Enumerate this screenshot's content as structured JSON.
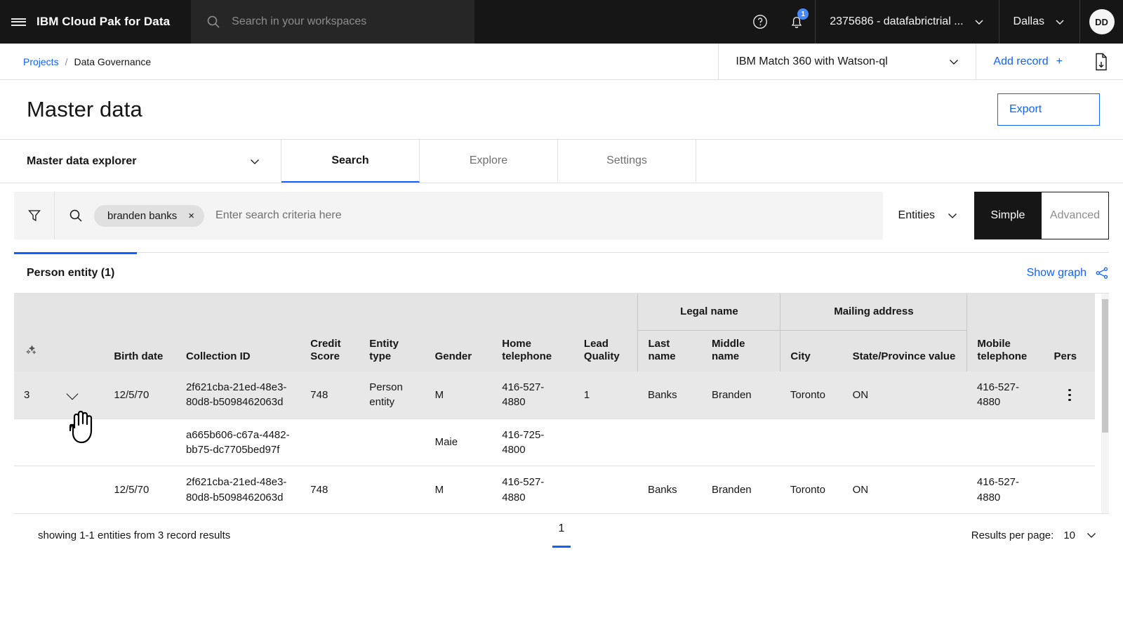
{
  "topbar": {
    "brand": "IBM Cloud Pak for Data",
    "search_placeholder": "Search in your workspaces",
    "search_value": "",
    "notification_count": "1",
    "account": "2375686 - datafabrictrial ...",
    "region": "Dallas",
    "avatar_initials": "DD"
  },
  "breadcrumb": {
    "projects": "Projects",
    "separator": "/",
    "current": "Data Governance",
    "asset": "IBM Match 360 with Watson-ql",
    "add_record": "Add record",
    "add_record_plus": "+"
  },
  "page": {
    "title": "Master data",
    "export_label": "Export"
  },
  "explorer": {
    "label": "Master data explorer",
    "tabs": [
      {
        "label": "Search",
        "active": true
      },
      {
        "label": "Explore",
        "active": false
      },
      {
        "label": "Settings",
        "active": false
      }
    ]
  },
  "search": {
    "chip_label": "branden banks",
    "chip_close": "×",
    "placeholder": "Enter search criteria here",
    "value": "",
    "scope": "Entities",
    "mode_simple": "Simple",
    "mode_advanced": "Advanced",
    "mode_selected": "Simple"
  },
  "results": {
    "entity_tab": "Person entity (1)",
    "show_graph": "Show graph"
  },
  "table": {
    "group_headers": [
      {
        "label": "Legal name",
        "span": 2
      },
      {
        "label": "Mailing address",
        "span": 2
      }
    ],
    "columns": [
      "Birth date",
      "Collection ID",
      "Credit Score",
      "Entity type",
      "Gender",
      "Home telephone",
      "Lead Quality",
      "Last name",
      "Middle name",
      "City",
      "State/Province value",
      "Mobile telephone",
      "Pers"
    ],
    "rows": [
      {
        "index": "3",
        "birth_date": "12/5/70",
        "collection_id": "2f621cba-21ed-48e3-80d8-b5098462063d",
        "credit_score": "748",
        "entity_type": "Person entity",
        "gender": "M",
        "home_telephone": "416-527-4880",
        "lead_quality": "1",
        "last_name": "Banks",
        "middle_name": "Branden",
        "city": "Toronto",
        "state_province": "ON",
        "mobile_telephone": "416-527-4880"
      },
      {
        "index": "",
        "birth_date": "",
        "collection_id": "a665b606-c67a-4482-bb75-dc7705bed97f",
        "credit_score": "",
        "entity_type": "",
        "gender": "Maie",
        "home_telephone": "416-725-4800",
        "lead_quality": "",
        "last_name": "",
        "middle_name": "",
        "city": "",
        "state_province": "",
        "mobile_telephone": ""
      },
      {
        "index": "",
        "birth_date": "12/5/70",
        "collection_id": "2f621cba-21ed-48e3-80d8-b5098462063d",
        "credit_score": "748",
        "entity_type": "",
        "gender": "M",
        "home_telephone": "416-527-4880",
        "lead_quality": "",
        "last_name": "Banks",
        "middle_name": "Branden",
        "city": "Toronto",
        "state_province": "ON",
        "mobile_telephone": "416-527-4880"
      }
    ]
  },
  "footer": {
    "showing": "showing 1-1 entities from 3 record results",
    "page": "1",
    "results_per_page_label": "Results per page:",
    "results_per_page_value": "10"
  },
  "colors": {
    "accent": "#0f62fe",
    "header_bg": "#161616",
    "table_header_bg": "#e4e4e4",
    "row_selected": "#e8e8e8"
  }
}
